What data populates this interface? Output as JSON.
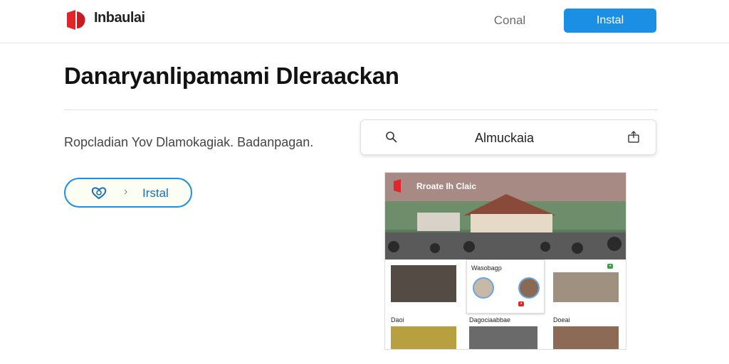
{
  "header": {
    "brand": "Inbaulai",
    "cancel_label": "Conal",
    "install_label": "Instal"
  },
  "main": {
    "title": "Danaryanlipamami Dleraackan",
    "subtitle": "Ropcladian Yov Dlamokagiak. Badanpagan.",
    "pill_label": "Irstal",
    "search_text": "Almuckaia"
  },
  "preview": {
    "hero_title": "Rroate Ih Claic",
    "card2_title": "Wasobagp",
    "card4_title": "Dagociaabbae",
    "card3_title": "Daoi",
    "card5_title": "Doeai"
  },
  "colors": {
    "accent": "#1a8fe3",
    "logo_red": "#e0262b"
  }
}
